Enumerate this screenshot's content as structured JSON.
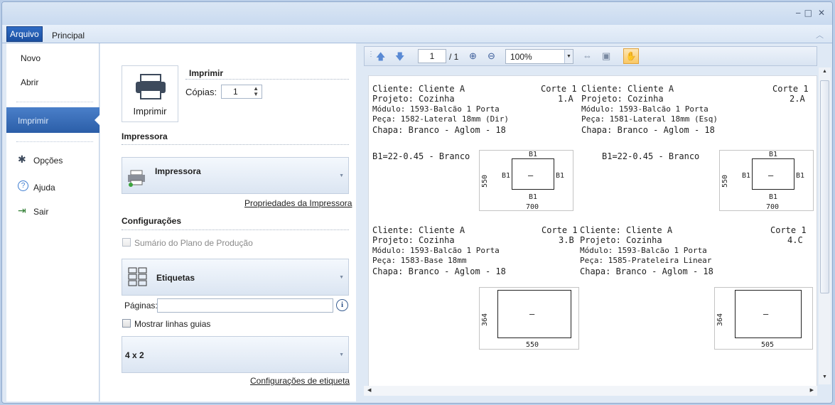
{
  "ribbon": {
    "tabs": [
      {
        "label": "Arquivo"
      },
      {
        "label": "Principal"
      }
    ]
  },
  "nav": {
    "items": [
      {
        "label": "Novo"
      },
      {
        "label": "Abrir"
      },
      {
        "label": "Imprimir"
      },
      {
        "label": "Opções"
      },
      {
        "label": "Ajuda"
      },
      {
        "label": "Sair"
      }
    ]
  },
  "print_panel": {
    "print_button_label": "Imprimir",
    "print_header": "Imprimir",
    "copies_label": "Cópias:",
    "copies_value": "1",
    "printer_header": "Impressora",
    "printer_combo": "Impressora",
    "printer_props_link": "Propriedades da Impressora",
    "config_header": "Configurações",
    "summary_checkbox": "Sumário do Plano de Produção",
    "layout_combo": "Etiquetas",
    "pages_label": "Páginas:",
    "pages_value": "",
    "guides_checkbox": "Mostrar linhas guias",
    "grid_combo": "4 x 2",
    "label_config_link": "Configurações de etiqueta"
  },
  "preview": {
    "page_current": "1",
    "page_total": "/ 1",
    "zoom": "100%",
    "labels": [
      {
        "client": "Cliente: Cliente A",
        "cut": "Corte 1",
        "project": "Projeto: Cozinha",
        "cut_id": "1.A",
        "module": "Módulo: 1593-Balcão 1 Porta",
        "piece": "Peça: 1582-Lateral 18mm (Dir)",
        "sheet": "Chapa: Branco - Aglom - 18",
        "edge": "B1=22-0.45 - Branco",
        "dim_w": "700",
        "dim_h": "550",
        "edge_code": "B1",
        "center_mark": "—"
      },
      {
        "client": "Cliente: Cliente A",
        "cut": "Corte 1",
        "project": "Projeto: Cozinha",
        "cut_id": "2.A",
        "module": "Módulo: 1593-Balcão 1 Porta",
        "piece": "Peça: 1581-Lateral 18mm (Esq)",
        "sheet": "Chapa: Branco - Aglom - 18",
        "edge": "B1=22-0.45 - Branco",
        "dim_w": "700",
        "dim_h": "550",
        "edge_code": "B1",
        "center_mark": "—"
      },
      {
        "client": "Cliente: Cliente A",
        "cut": "Corte 1",
        "project": "Projeto: Cozinha",
        "cut_id": "3.B",
        "module": "Módulo: 1593-Balcão 1 Porta",
        "piece": "Peça: 1583-Base 18mm",
        "sheet": "Chapa: Branco - Aglom - 18",
        "dim_w": "550",
        "dim_h": "364",
        "center_mark": "—"
      },
      {
        "client": "Cliente: Cliente A",
        "cut": "Corte 1",
        "project": "Projeto: Cozinha",
        "cut_id": "4.C",
        "module": "Módulo: 1593-Balcão 1 Porta",
        "piece": "Peça: 1585-Prateleira Linear",
        "sheet": "Chapa: Branco - Aglom - 18",
        "dim_w": "505",
        "dim_h": "364",
        "center_mark": "—"
      }
    ]
  }
}
